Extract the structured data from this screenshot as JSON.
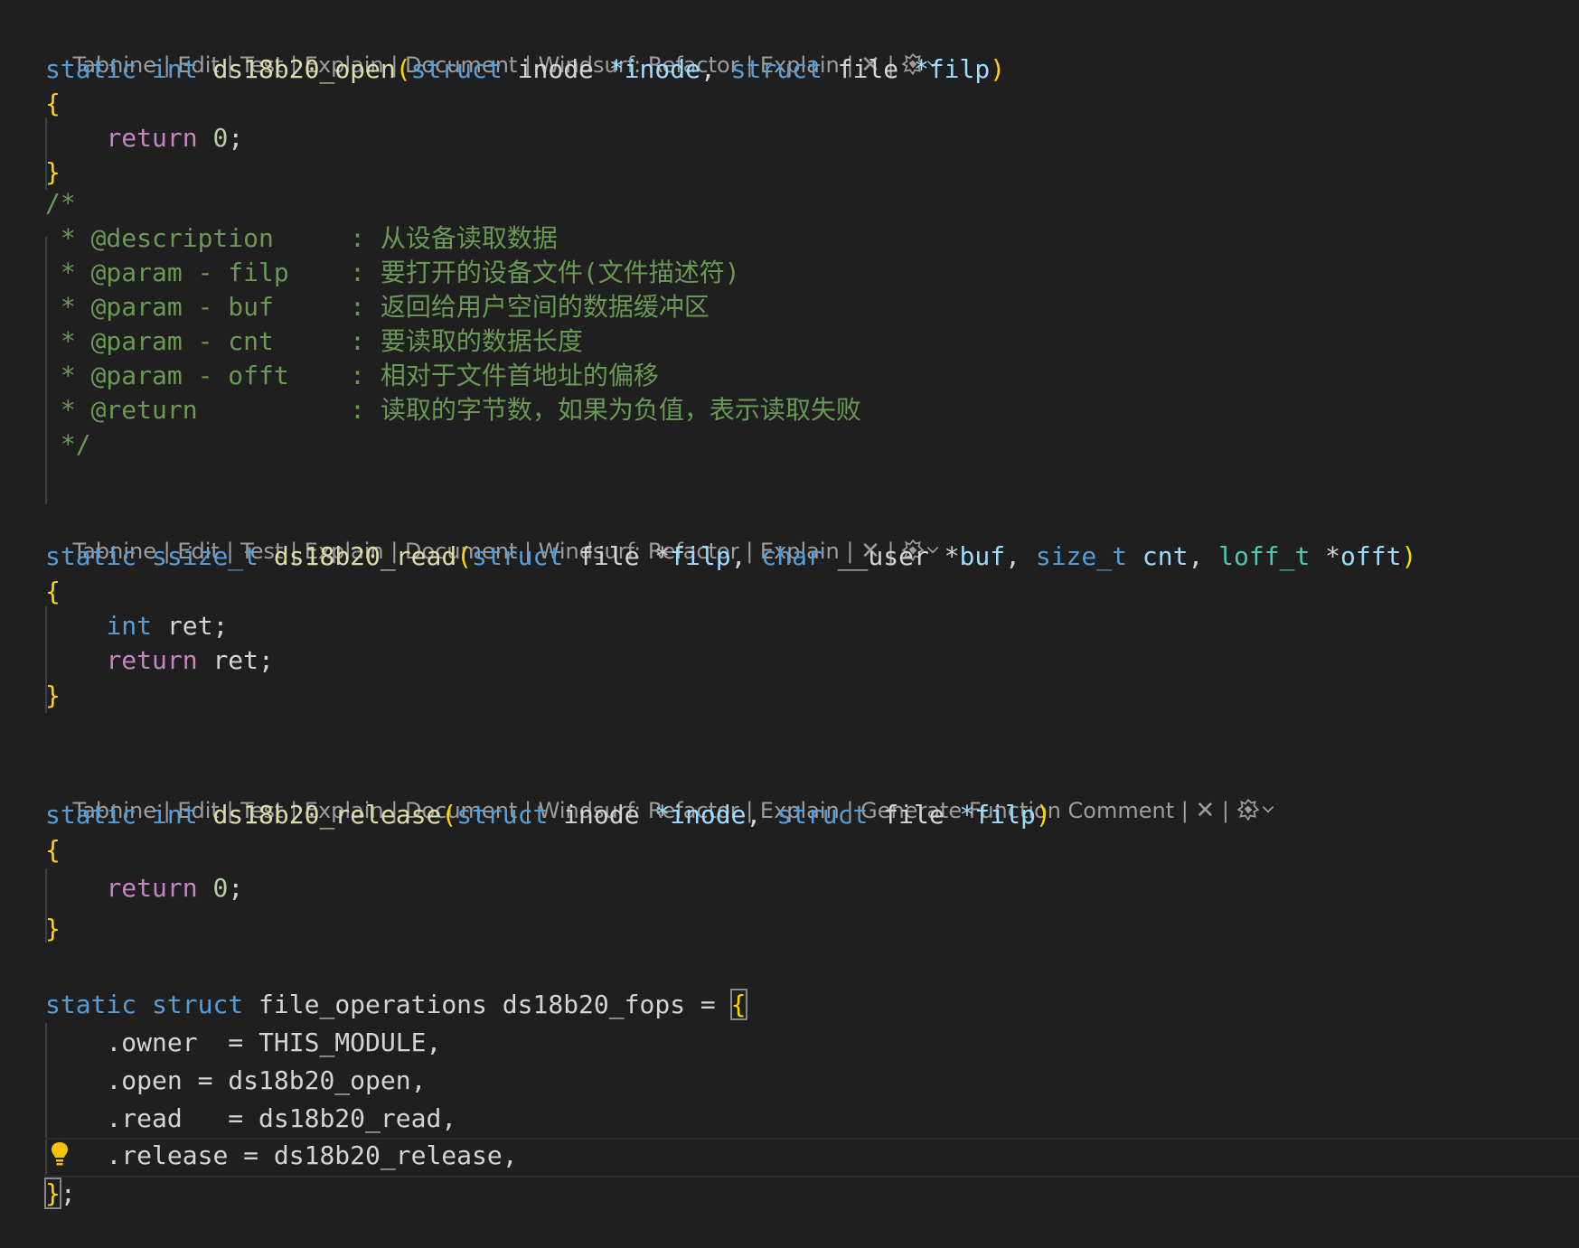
{
  "code_lens_1": {
    "items": [
      "Tabnine",
      "Edit",
      "Test",
      "Explain",
      "Document",
      "Windsurf: Refactor",
      "Explain"
    ],
    "close_glyph": "✕"
  },
  "code_lens_2": {
    "items": [
      "Tabnine",
      "Edit",
      "Test",
      "Explain",
      "Document",
      "Windsurf: Refactor",
      "Explain"
    ],
    "close_glyph": "✕"
  },
  "code_lens_3": {
    "items": [
      "Tabnine",
      "Edit",
      "Test",
      "Explain",
      "Document",
      "Windsurf: Refactor",
      "Explain",
      "Generate Function Comment"
    ],
    "close_glyph": "✕"
  },
  "code": {
    "open_kw_static": "static",
    "open_kw_int": "int",
    "open_fn": "ds18b20_open",
    "paren_open": "(",
    "paren_close": ")",
    "kw_struct": "struct",
    "t_inode": "inode",
    "p_inode": "*inode",
    "comma": ",",
    "t_file": "file",
    "p_filp": "*filp",
    "brace_open": "{",
    "brace_close": "}",
    "kw_return": "return",
    "zero": "0",
    "semi": ";",
    "c_open": "/*",
    "c_lines": [
      " * @description     : 从设备读取数据",
      " * @param - filp    : 要打开的设备文件(文件描述符)",
      " * @param - buf     : 返回给用户空间的数据缓冲区",
      " * @param - cnt     : 要读取的数据长度",
      " * @param - offt    : 相对于文件首地址的偏移",
      " * @return          : 读取的字节数，如果为负值，表示读取失败"
    ],
    "c_close": " */",
    "read_kw_ssize": "ssize_t",
    "read_fn": "ds18b20_read",
    "v_filp": "filp",
    "kw_char": "char",
    "t_user": "__user",
    "star": "*",
    "v_buf": "buf",
    "kw_size_t": "size_t",
    "v_cnt": "cnt",
    "t_loff": "loff_t",
    "v_offt": "offt",
    "t_ret": "ret",
    "v_ret": "ret",
    "release_fn": "ds18b20_release",
    "fops_type": "file_operations",
    "fops_name": "ds18b20_fops",
    "eq": "=",
    "f_owner": ".owner  = THIS_MODULE,",
    "f_open": ".open = ds18b20_open,",
    "f_read": ".read   = ds18b20_read,",
    "f_release": ".release = ds18b20_release,",
    "end_semi": ";"
  }
}
